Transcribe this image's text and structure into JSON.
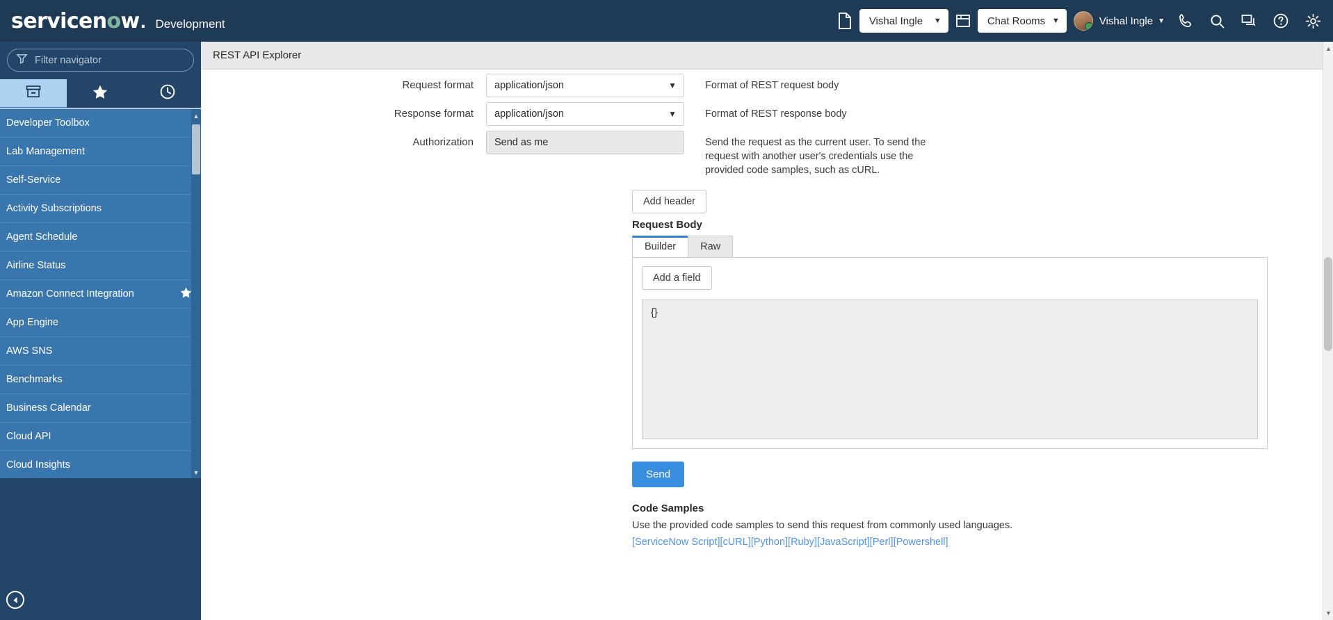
{
  "banner": {
    "logo_text_a": "servicen",
    "logo_text_o": "o",
    "logo_text_b": "w",
    "instance": "Development",
    "app_selector_value": "Vishal Ingle",
    "chat_selector_value": "Chat Rooms",
    "user_name": "Vishal Ingle",
    "icons": {
      "app_page": "page-icon",
      "window": "window-icon",
      "phone": "phone-icon",
      "search": "search-icon",
      "conversations": "conversations-icon",
      "help": "help-icon",
      "settings": "gear-icon"
    }
  },
  "sidebar": {
    "filter_placeholder": "Filter navigator",
    "tabs": [
      {
        "name": "all-applications",
        "icon": "box-icon",
        "active": true
      },
      {
        "name": "favorites",
        "icon": "star-icon",
        "active": false
      },
      {
        "name": "history",
        "icon": "clock-icon",
        "active": false
      }
    ],
    "items": [
      {
        "label": "Developer Toolbox",
        "favorite": false
      },
      {
        "label": "Lab Management",
        "favorite": false
      },
      {
        "label": "Self-Service",
        "favorite": false
      },
      {
        "label": "Activity Subscriptions",
        "favorite": false
      },
      {
        "label": "Agent Schedule",
        "favorite": false
      },
      {
        "label": "Airline Status",
        "favorite": false
      },
      {
        "label": "Amazon Connect Integration",
        "favorite": true
      },
      {
        "label": "App Engine",
        "favorite": false
      },
      {
        "label": "AWS SNS",
        "favorite": false
      },
      {
        "label": "Benchmarks",
        "favorite": false
      },
      {
        "label": "Business Calendar",
        "favorite": false
      },
      {
        "label": "Cloud API",
        "favorite": false
      },
      {
        "label": "Cloud Insights",
        "favorite": false
      }
    ],
    "collapse_icon": "collapse-left-icon"
  },
  "breadcrumb": {
    "title": "REST API Explorer"
  },
  "form": {
    "request_format": {
      "label": "Request format",
      "value": "application/json",
      "help": "Format of REST request body"
    },
    "response_format": {
      "label": "Response format",
      "value": "application/json",
      "help": "Format of REST response body"
    },
    "authorization": {
      "label": "Authorization",
      "value": "Send as me",
      "help": "Send the request as the current user. To send the request with another user's credentials use the provided code samples, such as cURL."
    },
    "add_header_label": "Add header"
  },
  "request_body": {
    "heading": "Request Body",
    "tabs": [
      {
        "label": "Builder",
        "active": true
      },
      {
        "label": "Raw",
        "active": false
      }
    ],
    "add_field_label": "Add a field",
    "json_value": "{}"
  },
  "send": {
    "label": "Send"
  },
  "code_samples": {
    "heading": "Code Samples",
    "description": "Use the provided code samples to send this request from commonly used languages.",
    "links": [
      "[ServiceNow Script]",
      "[cURL]",
      "[Python]",
      "[Ruby]",
      "[JavaScript]",
      "[Perl]",
      "[Powershell]"
    ]
  },
  "colors": {
    "banner_bg": "#1f3a54",
    "sidebar_bg": "#24456a",
    "nav_list_bg": "#3a76ae",
    "accent_blue": "#2a7fd4",
    "send_button": "#3a8ee0",
    "link_blue": "#5294e8",
    "crumb_bar": "#e8e8e8"
  }
}
